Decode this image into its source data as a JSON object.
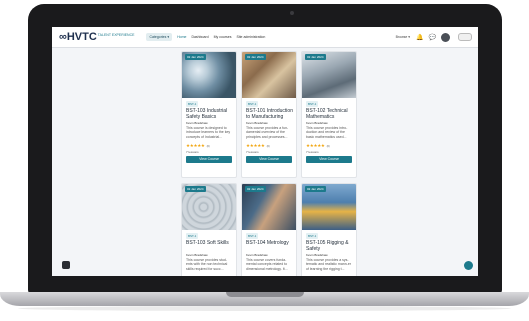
{
  "navbar": {
    "logo_mark": "∞",
    "logo_text": "HVTC",
    "logo_sub": "TALENT EXPERIENCE",
    "categories_label": "Categories ▾",
    "links": [
      "Home",
      "Dashboard",
      "My courses",
      "Site administration"
    ],
    "right_label": "Browse ▾"
  },
  "courses": [
    {
      "date": "02 Jan 2024",
      "code": "BST-1",
      "title": "BST-103 Industrial Safety Basics",
      "author": "Kevin Bradshaw",
      "desc": "This course is designed to introduce learners to the key concepts of Industrial...",
      "rating": "★★★★★",
      "rating_count": "(0)",
      "lessons": "7 lessons",
      "button": "View Course"
    },
    {
      "date": "02 Jan 2024",
      "code": "BST-1",
      "title": "BST-101 Introduction to Manufacturing",
      "author": "Kevin Bradshaw",
      "desc": "This course provides a fun-damental overview of the principles and processes...",
      "rating": "★★★★★",
      "rating_count": "(0)",
      "lessons": "7 lessons",
      "button": "View Course"
    },
    {
      "date": "02 Jan 2024",
      "code": "BST-1",
      "title": "BST-102 Technical Mathematics",
      "author": "Kevin Bradshaw",
      "desc": "This course provides intro-duction and review of the basic mathematics used...",
      "rating": "★★★★★",
      "rating_count": "(0)",
      "lessons": "7 lessons",
      "button": "View Course"
    },
    {
      "date": "02 Jan 2024",
      "code": "BST-1",
      "title": "BST-103 Soft Skills",
      "author": "Kevin Bradshaw",
      "desc": "This course provides stud-ents with the non technical skills required for succ...",
      "rating": "",
      "rating_count": "",
      "lessons": "",
      "button": ""
    },
    {
      "date": "02 Jan 2024",
      "code": "BST-1",
      "title": "BST-104 Metrology",
      "author": "Kevin Bradshaw",
      "desc": "This course covers funda-mental concepts related to dimensional metrology. It...",
      "rating": "",
      "rating_count": "",
      "lessons": "",
      "button": ""
    },
    {
      "date": "02 Jan 2024",
      "code": "BST-1",
      "title": "BST-105 Rigging & Safety",
      "author": "Kevin Bradshaw",
      "desc": "This course provides a sys-tematic and realistic mann-er of learning the rigging t...",
      "rating": "",
      "rating_count": "",
      "lessons": "",
      "button": ""
    }
  ]
}
